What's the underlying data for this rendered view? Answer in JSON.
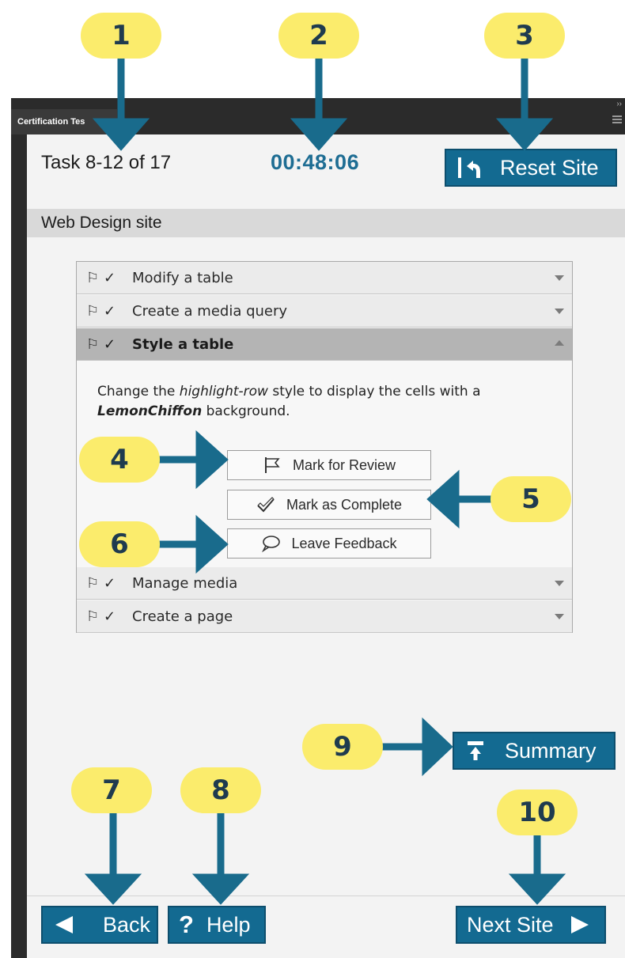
{
  "panel": {
    "tab_label": "Certification Tes"
  },
  "header": {
    "task_counter": "Task 8-12 of 17",
    "timer": "00:48:06",
    "reset_label": "Reset Site"
  },
  "site": {
    "name": "Web Design site"
  },
  "tasks": [
    {
      "title": "Modify a table",
      "expanded": false
    },
    {
      "title": "Create a media query",
      "expanded": false
    },
    {
      "title": "Style a table",
      "expanded": true
    },
    {
      "title": "Manage media",
      "expanded": false
    },
    {
      "title": "Create a page",
      "expanded": false
    }
  ],
  "task_detail": {
    "text_1": "Change the ",
    "text_italic": "highlight-row",
    "text_2": " style to display the cells with a ",
    "text_bold": "LemonChiffon",
    "text_3": " background.",
    "mark_review_label": "Mark for Review",
    "mark_complete_label": "Mark as Complete",
    "feedback_label": "Leave Feedback"
  },
  "footer": {
    "summary_label": "Summary",
    "back_label": "Back",
    "help_label": "Help",
    "next_label": "Next Site"
  },
  "callouts": [
    "1",
    "2",
    "3",
    "4",
    "5",
    "6",
    "7",
    "8",
    "9",
    "10"
  ],
  "icons": {
    "flag": "flag-icon",
    "check": "checkmark-icon",
    "reset": "reset-arrow-icon",
    "comment": "speech-bubble-icon",
    "summary": "summary-icon",
    "back": "left-arrow-icon",
    "help": "question-mark-icon",
    "next": "right-arrow-icon"
  },
  "colors": {
    "button": "#136a91",
    "callout": "#fbec6c",
    "arrow": "#196b8c",
    "timer": "#1e6d93"
  }
}
